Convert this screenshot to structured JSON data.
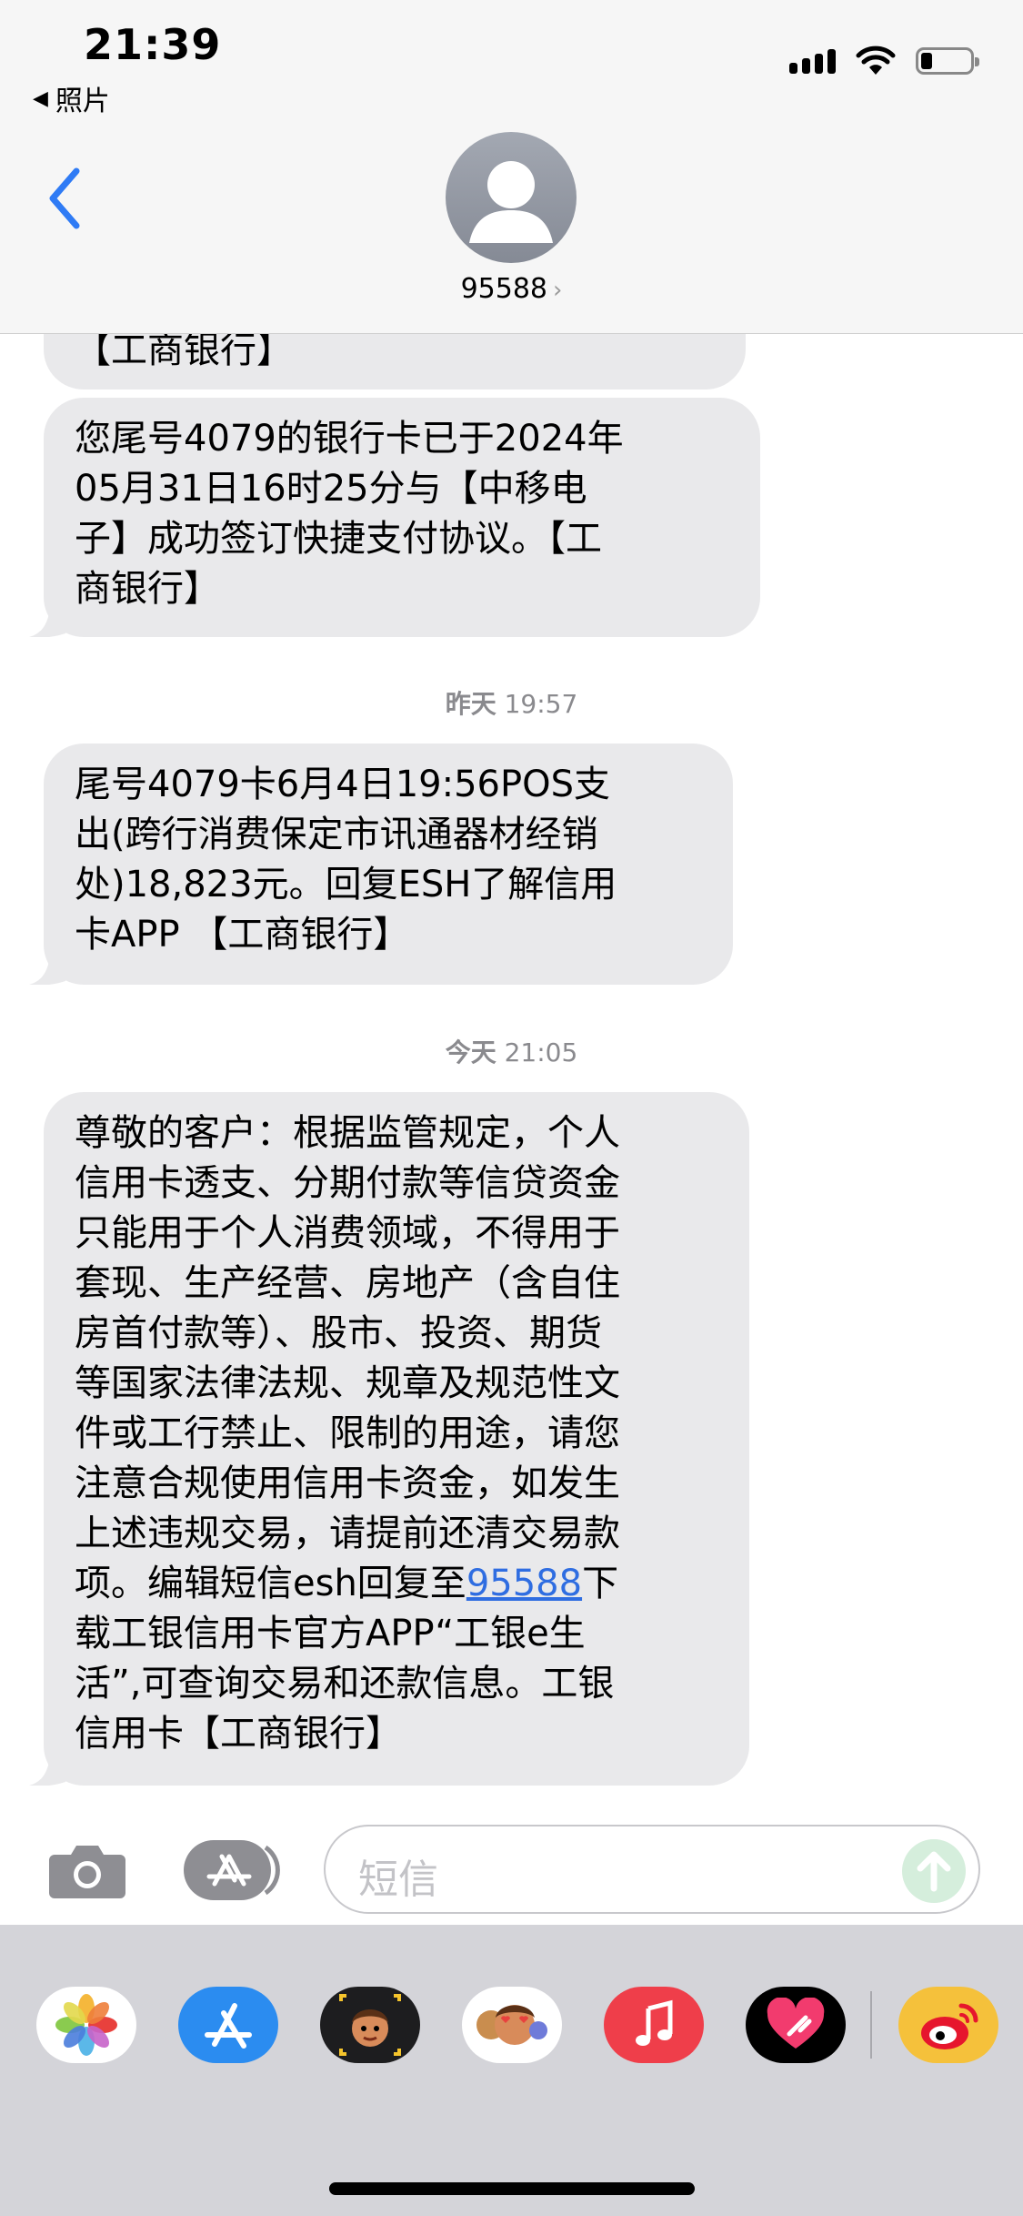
{
  "status_bar": {
    "time": "21:39",
    "back_app": "照片"
  },
  "contact": {
    "name": "95588"
  },
  "messages": [
    {
      "text": "【工商银行】"
    },
    {
      "text": "您尾号4079的银行卡已于2024年05月31日16时25分与【中移电子】成功签订快捷支付协议。【工商银行】",
      "lines": [
        "您尾号4079的银行卡已于2024年",
        "05月31日16时25分与【中移电",
        "子】成功签订快捷支付协议。【工",
        "商银行】"
      ]
    },
    {
      "timestamp_day": "昨天",
      "timestamp_time": "19:57"
    },
    {
      "lines": [
        "尾号4079卡6月4日19:56POS支",
        "出(跨行消费保定市讯通器材经销",
        "处)18,823元。回复ESH了解信用",
        "卡APP 【工商银行】"
      ]
    },
    {
      "timestamp_day": "今天",
      "timestamp_time": "21:05"
    },
    {
      "lines": [
        "尊敬的客户：根据监管规定，个人",
        "信用卡透支、分期付款等信贷资金",
        "只能用于个人消费领域，不得用于",
        "套现、生产经营、房地产（含自住",
        "房首付款等）、股市、投资、期货",
        "等国家法律法规、规章及规范性文",
        "件或工行禁止、限制的用途，请您",
        "注意合规使用信用卡资金，如发生",
        "上述违规交易，请提前还清交易款"
      ],
      "line10_before": "项。编辑短信esh回复至",
      "line10_link": "95588",
      "line10_after": "下",
      "tail_lines": [
        "载工银信用卡官方APP“工银e生",
        "活”,可查询交易和还款信息。工银",
        "信用卡【工商银行】"
      ]
    }
  ],
  "input": {
    "placeholder": "短信"
  },
  "colors": {
    "link": "#2f6de1",
    "bubble": "#e9e9eb",
    "accent": "#2f7bf5"
  },
  "dock_icons": [
    "photos-icon",
    "app-store-icon",
    "memoji-icon",
    "animoji-stickers-icon",
    "music-icon",
    "heart-digital-touch-icon",
    "weibo-icon"
  ]
}
